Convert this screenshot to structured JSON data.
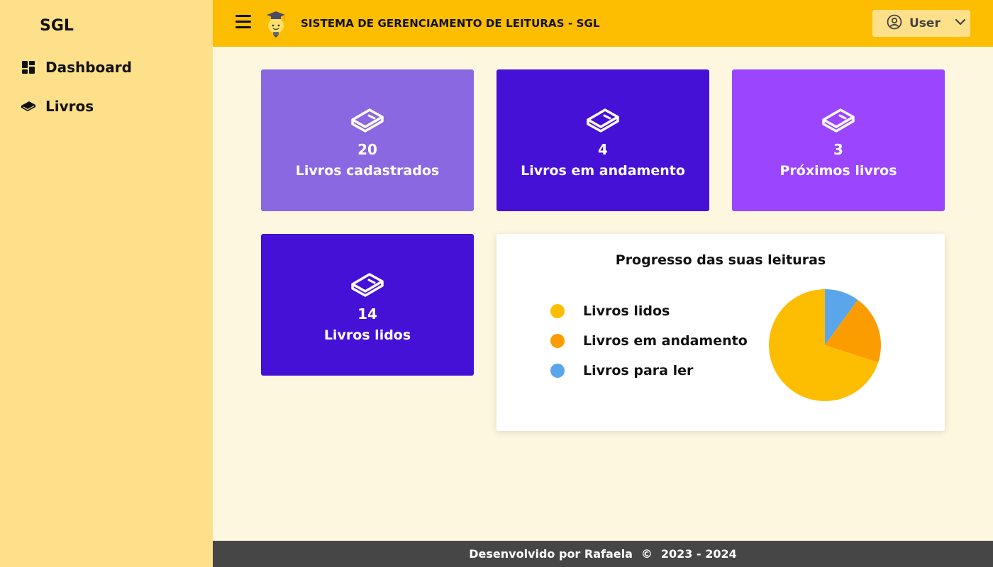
{
  "sidebar": {
    "brand": "SGL",
    "items": [
      {
        "label": "Dashboard",
        "icon": "dashboard-icon"
      },
      {
        "label": "Livros",
        "icon": "book-icon"
      }
    ]
  },
  "header": {
    "menu_icon": "hamburger-icon",
    "logo_icon": "lightbulb-graduation-cap-icon",
    "title": "SISTEMA DE GERENCIAMENTO DE LEITURAS - SGL",
    "user_label": "User",
    "user_icon": "user-circle-icon",
    "dropdown_icon": "chevron-down-icon"
  },
  "cards": [
    {
      "count": "20",
      "label": "Livros cadastrados",
      "color": "#8968e1",
      "icon": "book-icon"
    },
    {
      "count": "4",
      "label": "Livros em andamento",
      "color": "#4511d6",
      "icon": "book-icon"
    },
    {
      "count": "3",
      "label": "Próximos livros",
      "color": "#9b45ff",
      "icon": "book-icon"
    },
    {
      "count": "14",
      "label": "Livros lidos",
      "color": "#4511d6",
      "icon": "book-icon"
    }
  ],
  "chart_data": {
    "type": "pie",
    "title": "Progresso das suas leituras",
    "categories": [
      "Livros lidos",
      "Livros em andamento",
      "Livros para ler"
    ],
    "values": [
      14,
      4,
      2
    ],
    "colors": [
      "#fdbd00",
      "#fb9c00",
      "#5ba6ea"
    ],
    "legend_position": "left"
  },
  "footer": {
    "text": "Desenvolvido por Rafaela",
    "copyright": "©",
    "years": "2023 - 2024"
  },
  "colors": {
    "sidebar_bg": "#ffe08a",
    "topbar_bg": "#fdbd00",
    "page_bg": "#fef7df",
    "footer_bg": "#464646"
  }
}
